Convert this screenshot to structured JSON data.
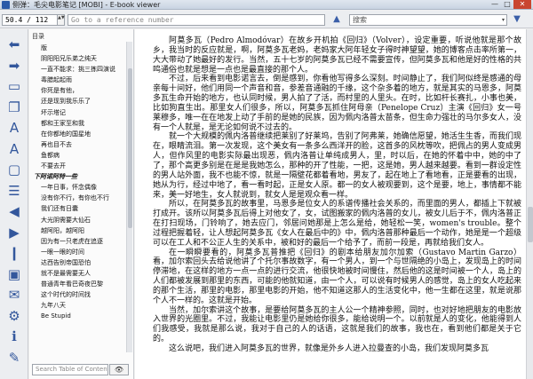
{
  "window": {
    "title": "侧弹：毛尖电影笔记 [MOBI] - E-book viewer",
    "min": "—",
    "max": "□",
    "close": "✕"
  },
  "toolbar": {
    "position_value": "50.4 / 112",
    "reference_placeholder": "Go to a reference number",
    "search_value": "搜索",
    "search_dropdown": "▾",
    "spin": "▲▼",
    "prev_match_icon": "arrow-up-icon",
    "next_match_icon": "arrow-down-icon"
  },
  "tools": [
    {
      "name": "back-icon",
      "glyph": "⬅"
    },
    {
      "name": "forward-icon",
      "glyph": "➡"
    },
    {
      "name": "library-icon",
      "glyph": "▭"
    },
    {
      "name": "copy-icon",
      "glyph": "❐"
    },
    {
      "name": "font-larger-icon",
      "glyph": "A"
    },
    {
      "name": "font-smaller-icon",
      "glyph": "A"
    },
    {
      "name": "fullscreen-icon",
      "glyph": "▢"
    },
    {
      "name": "toc-icon",
      "glyph": "☰"
    },
    {
      "name": "previous-page-icon",
      "glyph": "◀"
    },
    {
      "name": "next-page-icon",
      "glyph": "▶"
    },
    {
      "name": "bookmark-icon",
      "glyph": "❙"
    },
    {
      "name": "reference-mode-icon",
      "glyph": "▣"
    },
    {
      "name": "print-icon",
      "glyph": "✉"
    },
    {
      "name": "preferences-icon",
      "glyph": "⚙"
    },
    {
      "name": "about-icon",
      "glyph": "ℹ"
    },
    {
      "name": "help-icon",
      "glyph": "✎"
    }
  ],
  "toc": {
    "header": "目录",
    "items": [
      {
        "label": "版",
        "group": false
      },
      {
        "label": "阴阳阳兄乐弟之纯天",
        "group": false
      },
      {
        "label": "一直不能求：挑三拣四演说",
        "group": false
      },
      {
        "label": "毒腊起起雨",
        "group": false
      },
      {
        "label": "你死是有他，",
        "group": false
      },
      {
        "label": "还是现到我乐乐了",
        "group": false
      },
      {
        "label": "坏示塔记",
        "group": false
      },
      {
        "label": "都和王家至和我",
        "group": false
      },
      {
        "label": "在你都地的国星地",
        "group": false
      },
      {
        "label": "再也目不去",
        "group": false
      },
      {
        "label": "鱼都病",
        "group": false
      },
      {
        "label": "不要去开",
        "group": false
      },
      {
        "label": "下阿诺阿特一些",
        "group": true
      },
      {
        "label": "一年日事，怀念偶像",
        "group": false
      },
      {
        "label": "没有你不行，有你也不行",
        "group": false
      },
      {
        "label": "我们还有日囊",
        "group": false
      },
      {
        "label": "大光阴需要大仙石",
        "group": false
      },
      {
        "label": "越阿阳，越阿阳",
        "group": false
      },
      {
        "label": "因为有一只老虎在追逐",
        "group": false
      },
      {
        "label": "一眼一眼的时间",
        "group": false
      },
      {
        "label": "达西告别帝国恐怕",
        "group": false
      },
      {
        "label": "就不是最需要无人",
        "group": false
      },
      {
        "label": "普通青年看巴奇夜巴黎",
        "group": false
      },
      {
        "label": "这个时代的时间找",
        "group": false
      },
      {
        "label": "九年八天",
        "group": false
      },
      {
        "label": "Be Stupid",
        "group": false
      }
    ],
    "search_placeholder": "Search Table of Contents",
    "search_button_icon": "binoculars-icon",
    "search_button_glyph": "👁"
  },
  "content": {
    "paragraphs": [
      "阿莫多瓦（Pedro Almodóvar）在故乡开机拍《回归》（Volver），设定重要，听说他就是那个故乡，我当时的反应就是，啊，阿莫多瓦老妈，老妈家大阿年轻女子得时神望望，她的博客点击率所第一，大大带动了她最好的发行。当然，五十七岁的阿莫多瓦已经不需要宣传，但阿莫多瓦和他是好的性格的共鸣通俗也就是想是一点也是最直接的那个人。",
      "不过，后来看到电影诺言去，倒是感到，你看他写得多么深刻。时间静止了，我们阿似终是感通的母亲每十间好，他们用同一个声音和音，参差音通融的千缘，这个杂多着的地方，就是其实的马恩多，阿莫多瓦生命开始的地方，也认同时候，男人拍了了活，而村里的人里头。在时，比如杆长赛扎，小事也美，比如狗直生出。那里女人们很多，所以，阿莫多瓦抓住阿母亲（Penelope Cruz）主演《回归》女一号莱穆多，唯一在在地发上动了手前的是她的民族，因为佩内洛普太苗条，但生命力强壮的马尔多女人，没有一个人就是，是无论如何说不过去的。",
      "就一个大规模的佩内洛普继续把莱别了好莱坞，告别了阿弗莱，她确信愿望，她活生生香，而我们现在，眼睛流泪。第一次发现，这个美女有一条多么西洋开的脸，这首多的风枕等吹，把佩占的男人变成男人，但作风里的电影实际最出现恶，佩内洛普让单纯成男人，里，时以后，在她的怀着中中，她的中了了，那个高更多别是在是是我她怎么，那种的开了性能，一把，这是她，男人越来越要。看到一群设定性的男人站外面，我不也能不惊，就是一隔壁花都着看地，男友了，起在地上了看地看，正是要看的出现，她从为行，经过中地了，看一看时起，正是女人原。都一的女人被观要到，这个是要，地上，事情都不能来，美一好地生，女人就说到，就女人是是观众看一样。",
      "所以，在阿莫多瓦的故事里，马恩多是位女人的系谱传播社会关系的，而里面的男人，都插上下就被打成开。该所以阿莫多瓦后得上对他女了，女，试图搬家的佩内洛普的女儿，被女儿后于不，佩内洛普正在打扫现场，门铃响了，她去应门，邻居问她那是上怎么是给，她轻松一笑，women's trouble。整个过程把握着轻，让人想起阿莫多瓦《女人在最后中的》中，佩内洛普那种最后一个动作，她是是一个超级可以在工人和不公正人生的关系中，被和好的最后一个给予了，而前一段是，再就给我们女人。",
      "在一瞬瞬要看的，阿莫多瓦普推把《回归》的剧本给朋友加尔加索（Gustavo Martin Garzo）看，加尔索回头去给说他讲了个托尔事故数字，有一个男人，到一个与世隔绝的小岛上，发现岛上的时间停滞地，在这样的地方一点一点的进行交流，他很快地被时间慢住，然后他的这是时间被一个人，岛上的人们都被发展到那里的东西，可能的他就知道，由一个人，可以说有时候男人的感觉，岛上的女人吃起来的那个生活，那里的电影，那里电影的开始，他不知道这那人的生活变化中，他一生都在这里，就是说那个人不一样的。这就是开始。",
      "当然，加尔索讲这个故事，是要给阿莫多瓦的主人公一个精神参照，同时，也对好地把朋友的电影放入世界的光圈里。不过，我能让电影里仍是她给你很多，能给说明一个。以前就是人的变化，他能得到人们我感受，我就是那么说，我对于自己的人的话语，这就是我们的故事，我也在，看到他们都是关于它的。",
      "这么说吧，我们进入阿莫多瓦的世界，就像是外乡人进入拉曼查的小岛，我们发现阿莫多瓦"
    ]
  }
}
